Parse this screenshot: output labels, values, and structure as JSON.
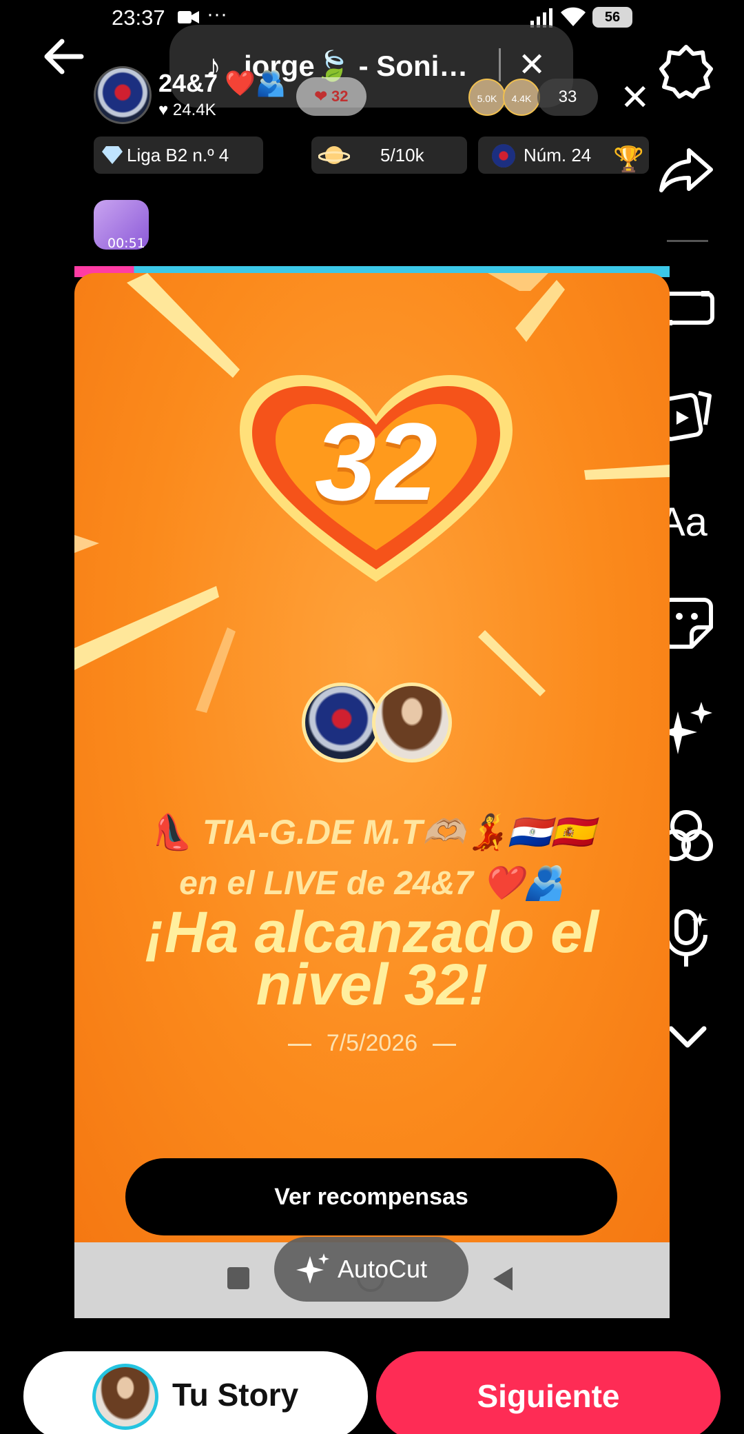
{
  "status_bar": {
    "time": "23:37",
    "battery": "56",
    "more": "···"
  },
  "music": {
    "title": "jorge🍃 - Soni…"
  },
  "live": {
    "host_name": "24&7 ❤️🫂",
    "likes": "24.4K",
    "follow_badge": "32",
    "viewers": [
      "5.0K",
      "4.4K"
    ],
    "viewer_count": "33",
    "league": "Liga B2 n.º 4",
    "progress": "5/10k",
    "rank": "Núm. 24",
    "gift_timer": "00:51"
  },
  "card": {
    "level": "32",
    "user_line": "👠 TIA-G.DE M.T🫶🏼💃🇵🇾🇪🇸",
    "live_line": "en el LIVE de 24&7 ❤️🫂",
    "headline": "¡Ha alcanzado el nivel 32!",
    "date": "7/5/2026",
    "rewards_button": "Ver recompensas"
  },
  "autocut": {
    "label": "AutoCut"
  },
  "toolbar": {
    "text_tool": "Aa"
  },
  "bottom": {
    "story_label": "Tu Story",
    "next_label": "Siguiente"
  },
  "colors": {
    "accent": "#fe2c55",
    "card_orange": "#fb8a1c",
    "headline_yellow": "#ffef9e"
  }
}
